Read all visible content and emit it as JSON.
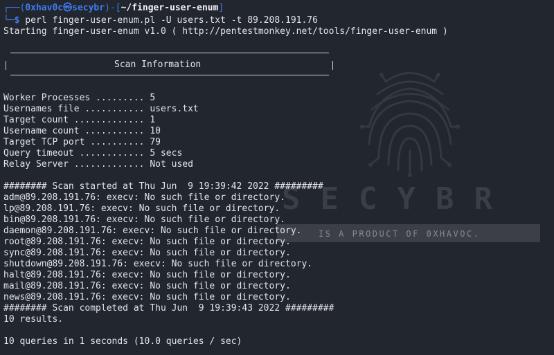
{
  "prompt": {
    "corner_top": "┌──(",
    "user": "0xhav0c",
    "at_symbol": "㉿",
    "host": "secybr",
    "dir_open": ")-[",
    "cwd": "~/finger-user-enum",
    "dir_close": "]",
    "corner_bottom": "└─",
    "dollar": "$",
    "command": " perl finger-user-enum.pl -U users.txt -t 89.208.191.76"
  },
  "starting_line": "Starting finger-user-enum v1.0 ( http://pentestmonkey.net/tools/finger-user-enum )",
  "scan_info_title": "Scan Information",
  "settings": [
    "Worker Processes ......... 5",
    "Usernames file ........... users.txt",
    "Target count ............. 1",
    "Username count ........... 10",
    "Target TCP port .......... 79",
    "Query timeout ............ 5 secs",
    "Relay Server ............. Not used"
  ],
  "scan_started": "######## Scan started at Thu Jun  9 19:39:42 2022 #########",
  "results": [
    "adm@89.208.191.76: execv: No such file or directory.",
    "lp@89.208.191.76: execv: No such file or directory.",
    "bin@89.208.191.76: execv: No such file or directory.",
    "daemon@89.208.191.76: execv: No such file or directory.",
    "root@89.208.191.76: execv: No such file or directory.",
    "sync@89.208.191.76: execv: No such file or directory.",
    "shutdown@89.208.191.76: execv: No such file or directory.",
    "halt@89.208.191.76: execv: No such file or directory.",
    "mail@89.208.191.76: execv: No such file or directory.",
    "news@89.208.191.76: execv: No such file or directory."
  ],
  "scan_completed": "######## Scan completed at Thu Jun  9 19:39:43 2022 #########",
  "results_count": "10 results.",
  "summary": "10 queries in 1 seconds (10.0 queries / sec)",
  "watermark": {
    "title": "SECYBR",
    "tagline": "IS A PRODUCT OF 0XHAVOC."
  },
  "colors": {
    "background": "#22262e",
    "prompt_blue": "#3d7cf0",
    "text": "#e2e6ea"
  }
}
